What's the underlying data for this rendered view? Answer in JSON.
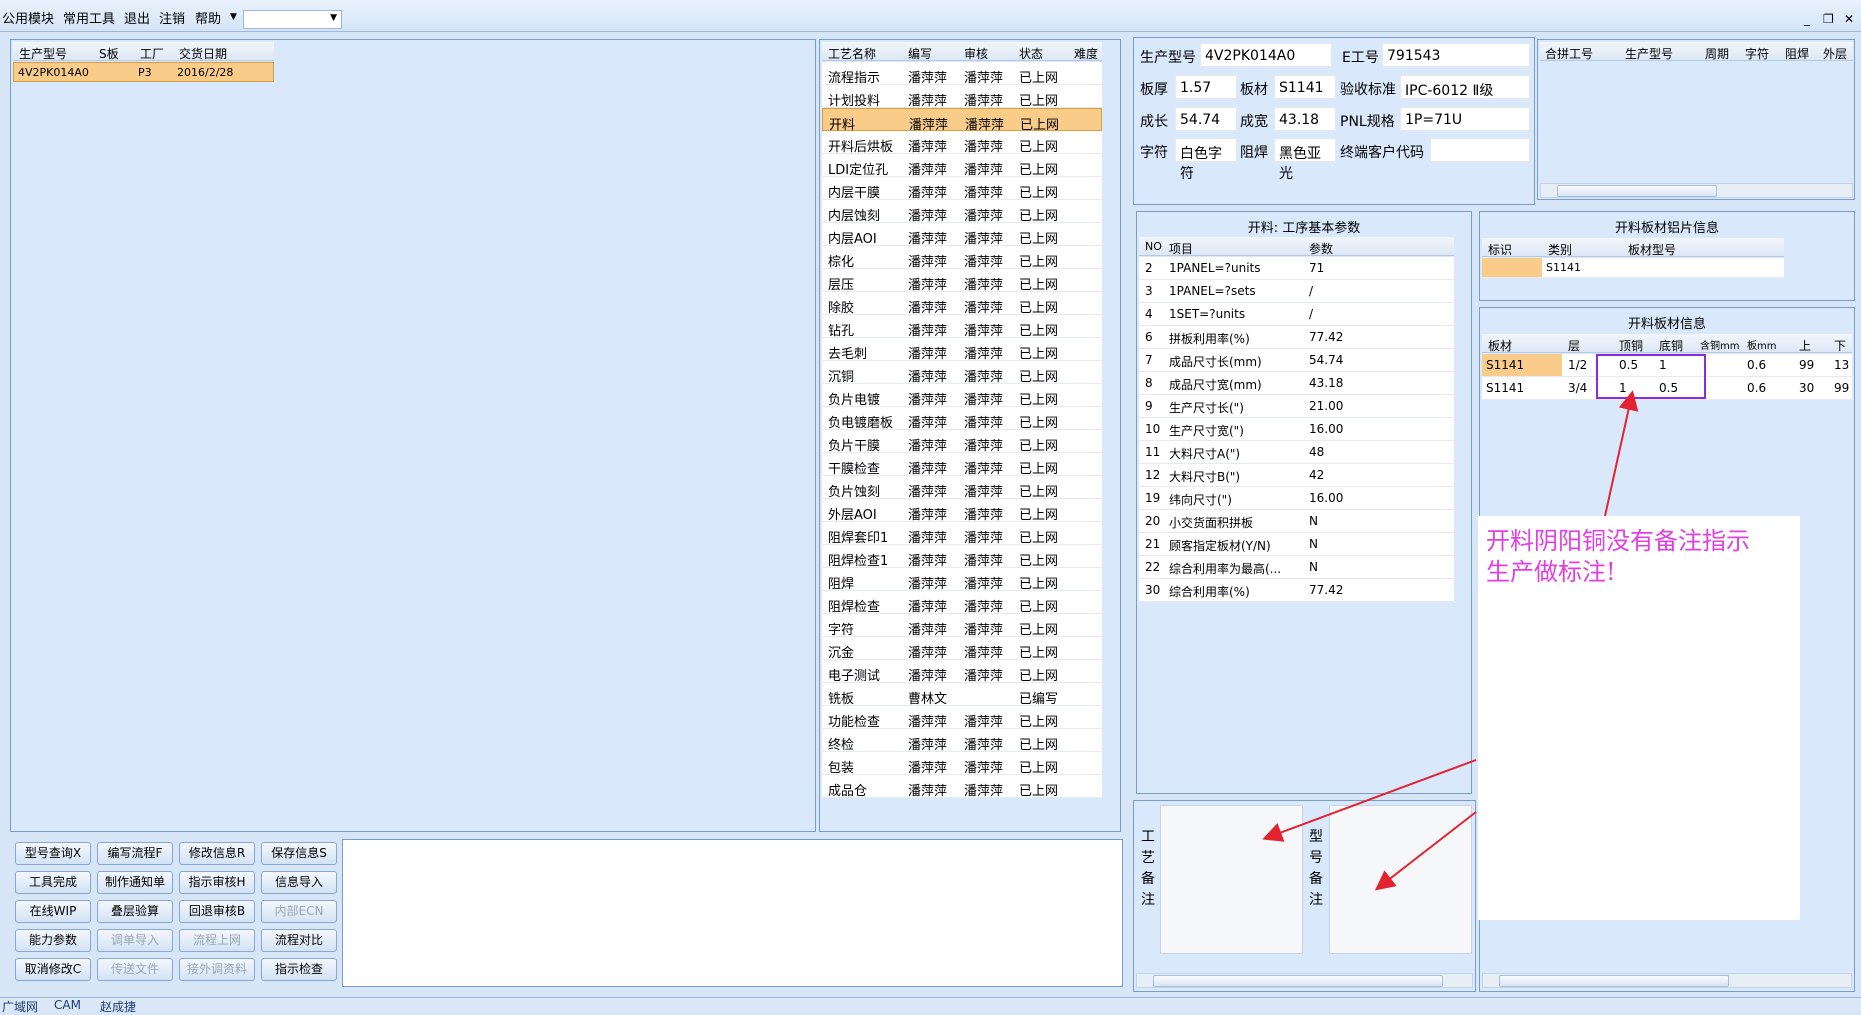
{
  "menu": {
    "items": [
      "公用模块",
      "常用工具",
      "退出",
      "注销",
      "帮助"
    ],
    "combo_value": ""
  },
  "window_controls": [
    "_",
    "❐",
    "✕"
  ],
  "orders": {
    "headers": [
      "生产型号",
      "S板",
      "工厂",
      "交货日期"
    ],
    "rows": [
      [
        "4V2PK014A0",
        "",
        "P3",
        "2016/2/28"
      ]
    ]
  },
  "process": {
    "headers": [
      "工艺名称",
      "编写",
      "审核",
      "状态",
      "难度"
    ],
    "selected_index": 2,
    "rows": [
      [
        "流程指示",
        "潘萍萍",
        "潘萍萍",
        "已上网",
        ""
      ],
      [
        "计划投料",
        "潘萍萍",
        "潘萍萍",
        "已上网",
        ""
      ],
      [
        "开料",
        "潘萍萍",
        "潘萍萍",
        "已上网",
        ""
      ],
      [
        "开料后烘板",
        "潘萍萍",
        "潘萍萍",
        "已上网",
        ""
      ],
      [
        "LDI定位孔",
        "潘萍萍",
        "潘萍萍",
        "已上网",
        ""
      ],
      [
        "内层干膜",
        "潘萍萍",
        "潘萍萍",
        "已上网",
        ""
      ],
      [
        "内层蚀刻",
        "潘萍萍",
        "潘萍萍",
        "已上网",
        ""
      ],
      [
        "内层AOI",
        "潘萍萍",
        "潘萍萍",
        "已上网",
        ""
      ],
      [
        "棕化",
        "潘萍萍",
        "潘萍萍",
        "已上网",
        ""
      ],
      [
        "层压",
        "潘萍萍",
        "潘萍萍",
        "已上网",
        ""
      ],
      [
        "除胶",
        "潘萍萍",
        "潘萍萍",
        "已上网",
        ""
      ],
      [
        "钻孔",
        "潘萍萍",
        "潘萍萍",
        "已上网",
        ""
      ],
      [
        "去毛刺",
        "潘萍萍",
        "潘萍萍",
        "已上网",
        ""
      ],
      [
        "沉铜",
        "潘萍萍",
        "潘萍萍",
        "已上网",
        ""
      ],
      [
        "负片电镀",
        "潘萍萍",
        "潘萍萍",
        "已上网",
        ""
      ],
      [
        "负电镀磨板",
        "潘萍萍",
        "潘萍萍",
        "已上网",
        ""
      ],
      [
        "负片干膜",
        "潘萍萍",
        "潘萍萍",
        "已上网",
        ""
      ],
      [
        "干膜检查",
        "潘萍萍",
        "潘萍萍",
        "已上网",
        ""
      ],
      [
        "负片蚀刻",
        "潘萍萍",
        "潘萍萍",
        "已上网",
        ""
      ],
      [
        "外层AOI",
        "潘萍萍",
        "潘萍萍",
        "已上网",
        ""
      ],
      [
        "阻焊套印1",
        "潘萍萍",
        "潘萍萍",
        "已上网",
        ""
      ],
      [
        "阻焊检查1",
        "潘萍萍",
        "潘萍萍",
        "已上网",
        ""
      ],
      [
        "阻焊",
        "潘萍萍",
        "潘萍萍",
        "已上网",
        ""
      ],
      [
        "阻焊检查",
        "潘萍萍",
        "潘萍萍",
        "已上网",
        ""
      ],
      [
        "字符",
        "潘萍萍",
        "潘萍萍",
        "已上网",
        ""
      ],
      [
        "沉金",
        "潘萍萍",
        "潘萍萍",
        "已上网",
        ""
      ],
      [
        "电子测试",
        "潘萍萍",
        "潘萍萍",
        "已上网",
        ""
      ],
      [
        "铣板",
        "曹林文",
        "",
        "已编写",
        ""
      ],
      [
        "功能检查",
        "潘萍萍",
        "潘萍萍",
        "已上网",
        ""
      ],
      [
        "终检",
        "潘萍萍",
        "潘萍萍",
        "已上网",
        ""
      ],
      [
        "包装",
        "潘萍萍",
        "潘萍萍",
        "已上网",
        ""
      ],
      [
        "成品仓",
        "潘萍萍",
        "潘萍萍",
        "已上网",
        ""
      ]
    ]
  },
  "info": {
    "model_label": "生产型号",
    "model": "4V2PK014A0",
    "e_label": "E工号",
    "e_no": "791543",
    "thick_label": "板厚",
    "thick": "1.57",
    "mat_label": "板材",
    "mat": "S1141",
    "std_label": "验收标准",
    "std": "IPC-6012 Ⅱ级",
    "len_label": "成长",
    "len": "54.74",
    "wid_label": "成宽",
    "wid": "43.18",
    "pnl_label": "PNL规格",
    "pnl": "1P=71U",
    "char_label": "字符",
    "char": "白色字符",
    "mask_label": "阻焊",
    "mask": "黑色亚光",
    "cust_label": "终端客户代码",
    "cust": ""
  },
  "merge": {
    "headers": [
      "合拼工号",
      "生产型号",
      "周期",
      "字符",
      "阻焊",
      "外层"
    ]
  },
  "params": {
    "title": "开料: 工序基本参数",
    "headers": [
      "NO",
      "项目",
      "参数"
    ],
    "rows": [
      [
        "2",
        "1PANEL=?units",
        "71"
      ],
      [
        "3",
        "1PANEL=?sets",
        "/"
      ],
      [
        "4",
        "1SET=?units",
        "/"
      ],
      [
        "6",
        "拼板利用率(%)",
        "77.42"
      ],
      [
        "7",
        "成品尺寸长(mm)",
        "54.74"
      ],
      [
        "8",
        "成品尺寸宽(mm)",
        "43.18"
      ],
      [
        "9",
        "生产尺寸长(\")",
        "21.00"
      ],
      [
        "10",
        "生产尺寸宽(\")",
        "16.00"
      ],
      [
        "11",
        "大料尺寸A(\")",
        "48"
      ],
      [
        "12",
        "大料尺寸B(\")",
        "42"
      ],
      [
        "19",
        "纬向尺寸(\")",
        "16.00"
      ],
      [
        "20",
        "小交货面积拼板",
        "N"
      ],
      [
        "21",
        "顾客指定板材(Y/N)",
        "N"
      ],
      [
        "22",
        "综合利用率为最高(...",
        "N"
      ],
      [
        "30",
        "综合利用率(%)",
        "77.42"
      ]
    ]
  },
  "sheet_info": {
    "title": "开料板材铝片信息",
    "headers": [
      "标识",
      "类别",
      "板材型号"
    ],
    "rows": [
      [
        "",
        "S1141",
        ""
      ]
    ]
  },
  "board_info": {
    "title": "开料板材信息",
    "headers": [
      "板材",
      "层",
      "顶铜",
      "底铜",
      "含铜mm",
      "板mm",
      "上",
      "下"
    ],
    "rows": [
      [
        "S1141",
        "1/2",
        "0.5",
        "1",
        "",
        "0.6",
        "99",
        "13"
      ],
      [
        "S1141",
        "3/4",
        "1",
        "0.5",
        "",
        "0.6",
        "30",
        "99"
      ]
    ]
  },
  "annotation": {
    "line1": "开料阴阳铜没有备注指示",
    "line2": "生产做标注!",
    "color": "#e040e0"
  },
  "remarks": {
    "craft_label": "工艺备注",
    "model_label": "型号备注"
  },
  "buttons": [
    [
      "型号查询X",
      "编写流程F",
      "修改信息R",
      "保存信息S"
    ],
    [
      "工具完成",
      "制作通知单",
      "指示审核H",
      "信息导入"
    ],
    [
      "在线WIP",
      "叠层验算",
      "回退审核B",
      "内部ECN"
    ],
    [
      "能力参数",
      "调单导入",
      "流程上网",
      "流程对比"
    ],
    [
      "取消修改C",
      "传送文件",
      "接外调资料",
      "指示检查"
    ]
  ],
  "status": {
    "items": [
      "广域网",
      "CAM",
      "赵成捷"
    ]
  }
}
